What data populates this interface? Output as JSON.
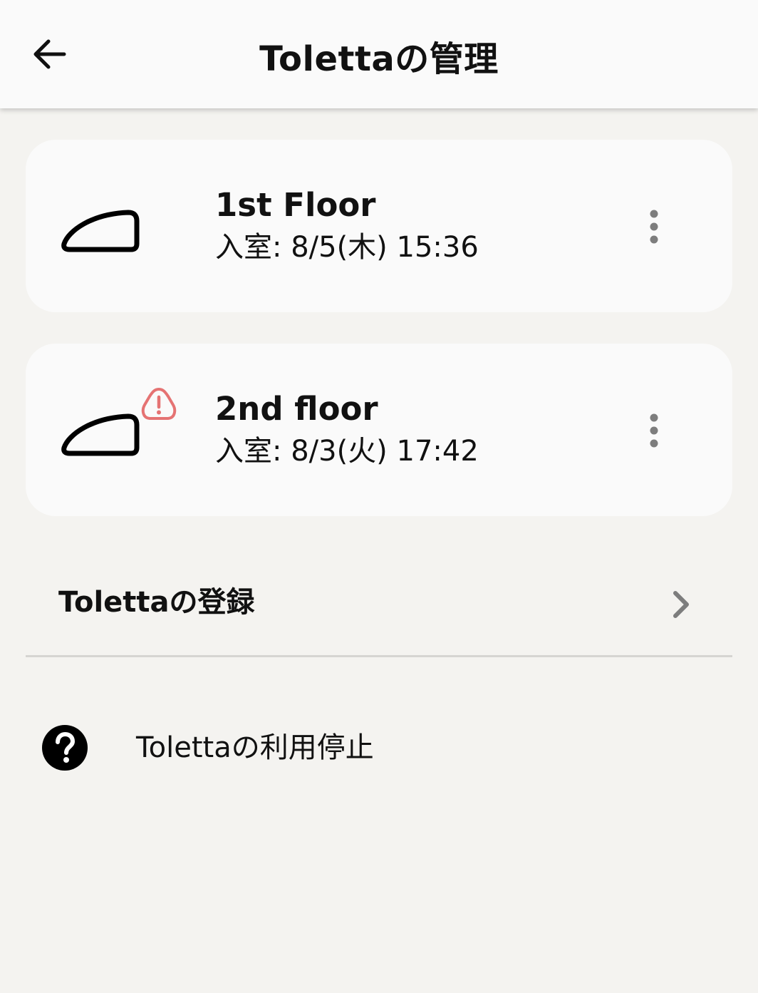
{
  "header": {
    "title": "Tolettaの管理",
    "back_icon": "arrow-left-icon"
  },
  "devices": [
    {
      "name": "1st Floor",
      "entry": "入室: 8/5(木) 15:36",
      "alert": false,
      "icon": "toilet-device-icon"
    },
    {
      "name": "2nd floor",
      "entry": "入室: 8/3(火) 17:42",
      "alert": true,
      "alert_color": "#e57373",
      "icon": "toilet-device-icon"
    }
  ],
  "menu": {
    "register_label": "Tolettaの登録",
    "stop_label": "Tolettaの利用停止"
  },
  "colors": {
    "background": "#f4f3f0",
    "card": "#fafafa",
    "alert": "#e57373",
    "muted_icon": "#7d7d7d"
  }
}
